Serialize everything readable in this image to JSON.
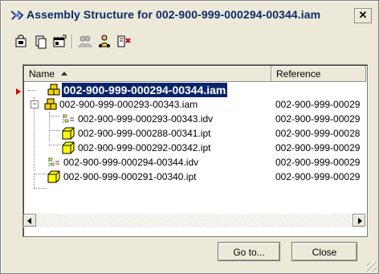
{
  "window": {
    "title": "Assembly Structure for 002-900-999-000294-00344.iam",
    "close_glyph": "✕"
  },
  "toolbar": {
    "icons": [
      "open-icon",
      "copy-icon",
      "properties-icon",
      "people-icon",
      "user-add-icon",
      "split-icon"
    ]
  },
  "tree": {
    "columns": {
      "name": "Name",
      "reference": "Reference"
    },
    "rows": [
      {
        "name": "002-900-999-000294-00344.iam",
        "reference": "",
        "icon": "assembly-icon",
        "selected": true
      },
      {
        "name": "002-900-999-000293-00343.iam",
        "reference": "002-900-999-00029",
        "icon": "assembly-icon"
      },
      {
        "name": "002-900-999-000293-00343.idv",
        "reference": "002-900-999-00029",
        "icon": "drawing-view-icon"
      },
      {
        "name": "002-900-999-000288-00341.ipt",
        "reference": "002-900-999-00028",
        "icon": "part-icon"
      },
      {
        "name": "002-900-999-000292-00342.ipt",
        "reference": "002-900-999-00029",
        "icon": "part-icon"
      },
      {
        "name": "002-900-999-000294-00344.idv",
        "reference": "002-900-999-00029",
        "icon": "drawing-view-icon"
      },
      {
        "name": "002-900-999-000291-00340.ipt",
        "reference": "002-900-999-00029",
        "icon": "part-icon"
      }
    ]
  },
  "buttons": {
    "goto": "Go to...",
    "close": "Close"
  },
  "colors": {
    "selection": "#0a246a",
    "dialog": "#ece9d8",
    "part_yellow": "#ffff00",
    "assembly_yellow": "#f5d400"
  }
}
